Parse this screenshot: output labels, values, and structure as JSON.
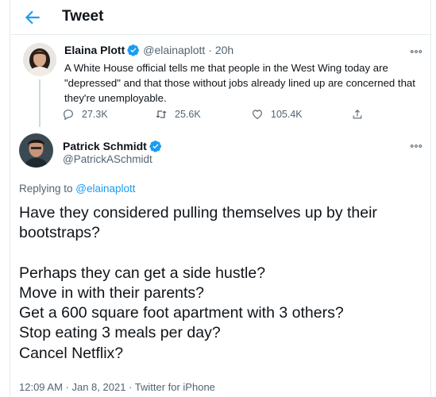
{
  "header": {
    "title": "Tweet"
  },
  "colors": {
    "accent": "#1d9bf0",
    "text": "#0f1419",
    "muted": "#536471",
    "border": "#e6ecf0"
  },
  "tweet1": {
    "name": "Elaina Plott",
    "handle": "@elainaplott",
    "time": "· 20h",
    "text": "A White House official tells me that people in the West Wing today are \"depressed\" and that those without jobs already lined up are concerned that they're unemployable.",
    "actions": {
      "replies": "27.3K",
      "retweets": "25.6K",
      "likes": "105.4K"
    }
  },
  "tweet2": {
    "name": "Patrick Schmidt",
    "handle": "@PatrickASchmidt",
    "replying_prefix": "Replying to ",
    "replying_to": "@elainaplott",
    "lines": [
      "Have they considered pulling themselves up by their bootstraps?",
      "Perhaps they can get a side hustle?",
      "Move in with their parents?",
      "Get a 600 square foot apartment with 3 others?",
      "Stop eating 3 meals per day?",
      "Cancel Netflix?"
    ],
    "meta": "12:09 AM · Jan 8, 2021 · Twitter for iPhone"
  }
}
